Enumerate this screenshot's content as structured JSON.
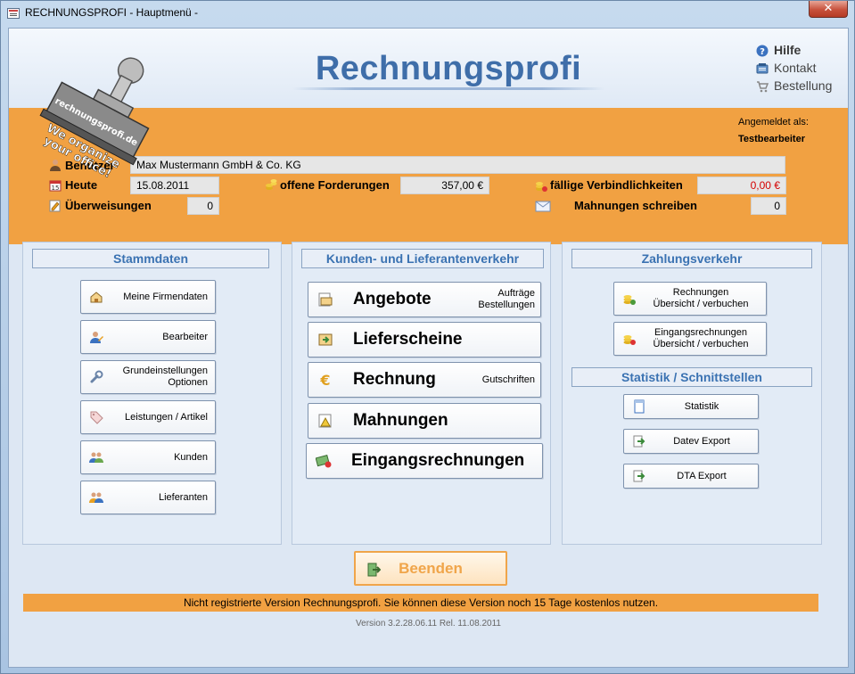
{
  "window": {
    "title": "RECHNUNGSPROFI  - Hauptmenü -",
    "close_glyph": "✕"
  },
  "brand": {
    "title": "Rechnungsprofi"
  },
  "stamp": {
    "domain": "rechnungsprofi.de",
    "slogan_line1": "We organize",
    "slogan_line2": "your office!"
  },
  "top_links": [
    {
      "label": "Hilfe",
      "icon": "help-icon"
    },
    {
      "label": "Kontakt",
      "icon": "contact-icon"
    },
    {
      "label": "Bestellung",
      "icon": "cart-icon"
    }
  ],
  "login": {
    "label": "Angemeldet als:",
    "user": "Testbearbeiter"
  },
  "info": {
    "user_label": "Benutzer",
    "user_value": "Max Mustermann GmbH & Co. KG",
    "today_label": "Heute",
    "today_value": "15.08.2011",
    "transfers_label": "Überweisungen",
    "transfers_value": "0",
    "receivables_label": "offene Forderungen",
    "receivables_value": "357,00 €",
    "liabilities_label": "fällige Verbindlichkeiten",
    "liabilities_value": "0,00 €",
    "reminders_label": "Mahnungen schreiben",
    "reminders_value": "0"
  },
  "stammdaten": {
    "title": "Stammdaten",
    "buttons": [
      {
        "label": "Meine Firmendaten",
        "icon": "home-icon"
      },
      {
        "label": "Bearbeiter",
        "icon": "user-edit-icon"
      },
      {
        "label": "Grundeinstellungen\nOptionen",
        "icon": "wrench-icon"
      },
      {
        "label": "Leistungen / Artikel",
        "icon": "tag-icon"
      },
      {
        "label": "Kunden",
        "icon": "customers-icon"
      },
      {
        "label": "Lieferanten",
        "icon": "suppliers-icon"
      }
    ]
  },
  "verkehr": {
    "title": "Kunden- und Lieferantenverkehr",
    "buttons": [
      {
        "label": "Angebote",
        "sub": "Aufträge\nBestellungen",
        "icon": "quote-icon"
      },
      {
        "label": "Lieferscheine",
        "sub": "",
        "icon": "delivery-icon"
      },
      {
        "label": "Rechnung",
        "sub": "Gutschriften",
        "icon": "euro-icon"
      },
      {
        "label": "Mahnungen",
        "sub": "",
        "icon": "reminder-icon"
      },
      {
        "label": "Eingangsrechnungen",
        "sub": "",
        "icon": "incoming-invoice-icon"
      }
    ]
  },
  "zahlung": {
    "title": "Zahlungsverkehr",
    "buttons": [
      {
        "label": "Rechnungen\nÜbersicht / verbuchen",
        "icon": "coins-add-icon"
      },
      {
        "label": "Eingangsrechnungen\nÜbersicht / verbuchen",
        "icon": "coins-remove-icon"
      }
    ]
  },
  "statistik": {
    "title": "Statistik / Schnittstellen",
    "buttons": [
      {
        "label": "Statistik",
        "icon": "document-icon"
      },
      {
        "label": "Datev Export",
        "icon": "export-icon"
      },
      {
        "label": "DTA Export",
        "icon": "export-icon"
      }
    ]
  },
  "quit": {
    "label": "Beenden",
    "icon": "exit-icon"
  },
  "notice": "Nicht registrierte Version Rechnungsprofi. Sie können diese Version noch 15 Tage kostenlos nutzen.",
  "version": "Version 3.2.28.06.11 Rel. 11.08.2011",
  "colors": {
    "orange": "#f1a142",
    "brand_blue": "#3f6ea9",
    "panel_head": "#3a72b2",
    "negative_red": "#d40000"
  }
}
